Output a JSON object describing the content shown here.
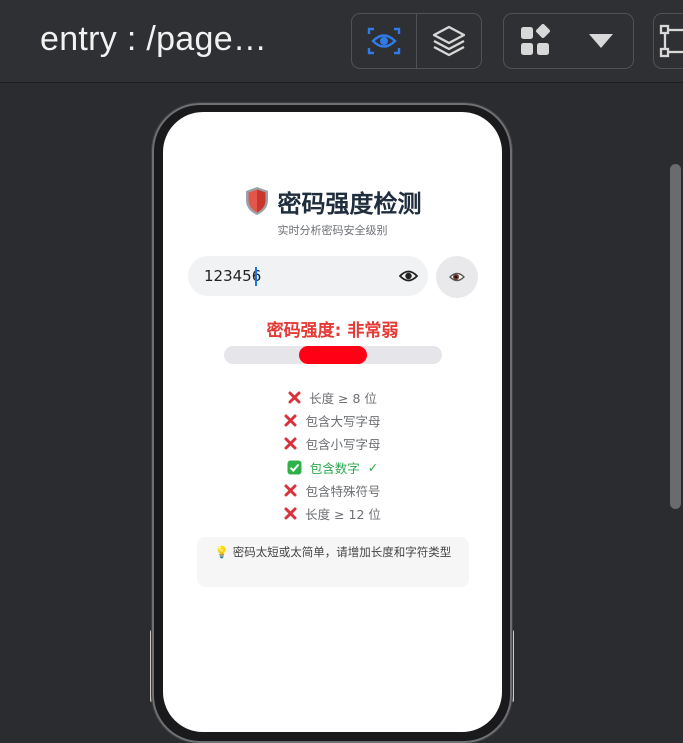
{
  "toolbar": {
    "title": "entry : /page…",
    "icons": [
      "eye-icon",
      "layers-icon",
      "components-icon",
      "dropdown-icon",
      "select-frame-icon"
    ],
    "accent_color": "#2f7be8"
  },
  "app": {
    "title": "密码强度检测",
    "subtitle": "实时分析密码安全级别",
    "password_value": "123456",
    "strength_label": "密码强度: 非常弱",
    "strength_level": 0.2,
    "strength_color": "#ff0014",
    "rules": [
      {
        "label": "长度 ≥ 8 位",
        "met": false
      },
      {
        "label": "包含大写字母",
        "met": false
      },
      {
        "label": "包含小写字母",
        "met": false
      },
      {
        "label": "包含数字",
        "met": true,
        "check": "✓"
      },
      {
        "label": "包含特殊符号",
        "met": false
      },
      {
        "label": "长度 ≥ 12 位",
        "met": false
      }
    ],
    "tip": "密码太短或太简单，请增加长度和字符类型"
  }
}
